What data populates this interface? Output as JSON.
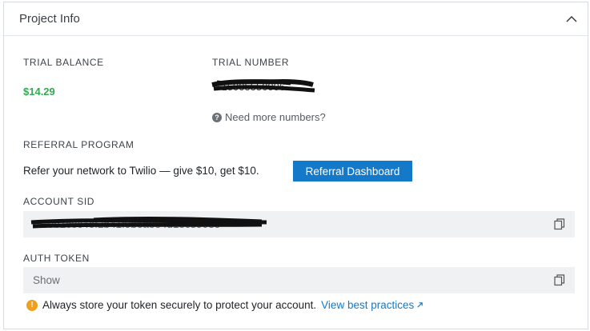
{
  "panel": {
    "title": "Project Info",
    "collapse_icon": "chevron-up-icon"
  },
  "trial_balance": {
    "label": "TRIAL BALANCE",
    "value": "$14.29",
    "value_color": "#36a852"
  },
  "trial_number": {
    "label": "TRIAL NUMBER",
    "value": "+15005550006",
    "redacted": true,
    "help_icon": "question-circle-icon",
    "help_link": "Need more numbers?"
  },
  "referral": {
    "label": "REFERRAL PROGRAM",
    "text": "Refer your network to Twilio — give $10, get $10.",
    "button": "Referral Dashboard",
    "button_color": "#1479c9"
  },
  "account_sid": {
    "label": "ACCOUNT SID",
    "value": "AC0b1c8c4ef2b41f9b6a8e4d18c39035",
    "redacted": true,
    "copy_icon": "copy-icon"
  },
  "auth_token": {
    "label": "AUTH TOKEN",
    "value": "Show",
    "copy_icon": "copy-icon"
  },
  "warning": {
    "icon": "warning-icon",
    "text": "Always store your token securely to protect your account.",
    "link": "View best practices",
    "link_icon": "external-link-icon"
  }
}
